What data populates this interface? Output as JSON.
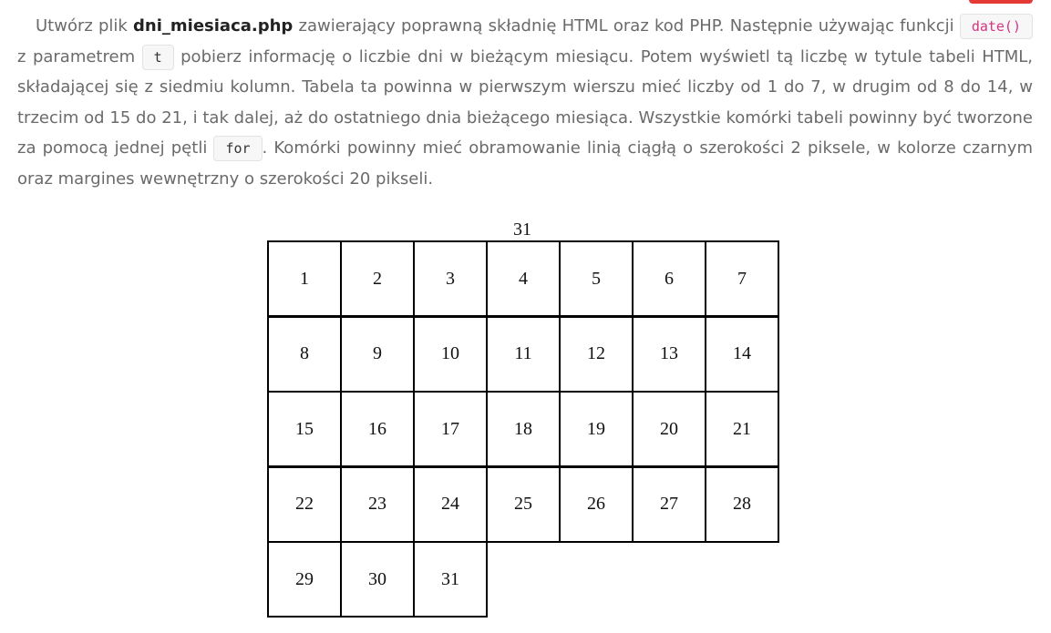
{
  "task": {
    "part1": "Utwórz plik ",
    "filename": "dni_miesiaca.php",
    "part2": " zawierający poprawną składnię HTML oraz kod PHP. Następnie używając funkcji ",
    "code_date": "date()",
    "part3": " z parametrem ",
    "code_t": "t",
    "part4": " pobierz informację o liczbie dni w bieżącym miesiącu. Potem wyświetl tą liczbę w tytule tabeli HTML, składającej się z siedmiu kolumn. Tabela ta powinna w pierwszym wierszu mieć liczby od 1 do 7, w drugim od 8 do 14, w trzecim od 15 do 21, i tak dalej, aż do ostatniego dnia bieżącego miesiąca. Wszystkie komórki tabeli powinny być tworzone za pomocą jednej pętli ",
    "code_for": "for",
    "part5": ". Komórki powinny mieć obramowanie linią ciągłą o szerokości 2 piksele, w kolorze czarnym oraz margines wewnętrzny o szerokości 20 pikseli."
  },
  "table": {
    "title": "31",
    "columns": 7,
    "days": [
      "1",
      "2",
      "3",
      "4",
      "5",
      "6",
      "7",
      "8",
      "9",
      "10",
      "11",
      "12",
      "13",
      "14",
      "15",
      "16",
      "17",
      "18",
      "19",
      "20",
      "21",
      "22",
      "23",
      "24",
      "25",
      "26",
      "27",
      "28",
      "29",
      "30",
      "31"
    ]
  },
  "colors": {
    "text": "#6a6a6a",
    "bold": "#222222",
    "code_pink": "#d63384",
    "accent": "#e53935",
    "border": "#000000"
  }
}
